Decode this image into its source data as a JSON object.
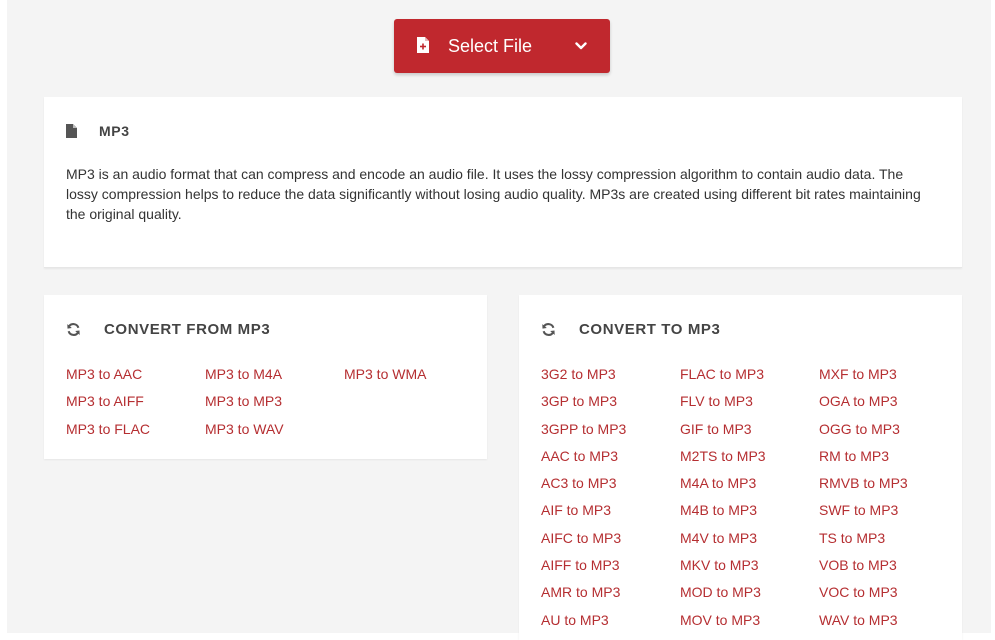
{
  "select_file": {
    "label": "Select File",
    "icon": "file-plus-icon",
    "dropdown_icon": "chevron-down-icon"
  },
  "format_info": {
    "icon": "document-icon",
    "name": "MP3",
    "description": "MP3 is an audio format that can compress and encode an audio file. It uses the lossy compression algorithm to contain audio data. The lossy compression helps to reduce the data significantly without losing audio quality. MP3s are created using different bit rates maintaining the original quality."
  },
  "convert_from": {
    "icon": "refresh-icon",
    "title": "CONVERT FROM MP3",
    "links": [
      "MP3 to AAC",
      "MP3 to AIFF",
      "MP3 to FLAC",
      "MP3 to M4A",
      "MP3 to MP3",
      "MP3 to WAV",
      "MP3 to WMA"
    ]
  },
  "convert_to": {
    "icon": "refresh-icon",
    "title": "CONVERT TO MP3",
    "links": [
      "3G2 to MP3",
      "3GP to MP3",
      "3GPP to MP3",
      "AAC to MP3",
      "AC3 to MP3",
      "AIF to MP3",
      "AIFC to MP3",
      "AIFF to MP3",
      "AMR to MP3",
      "AU to MP3",
      "FLAC to MP3",
      "FLV to MP3",
      "GIF to MP3",
      "M2TS to MP3",
      "M4A to MP3",
      "M4B to MP3",
      "M4V to MP3",
      "MKV to MP3",
      "MOD to MP3",
      "MOV to MP3",
      "MXF to MP3",
      "OGA to MP3",
      "OGG to MP3",
      "RM to MP3",
      "RMVB to MP3",
      "SWF to MP3",
      "TS to MP3",
      "VOB to MP3",
      "VOC to MP3",
      "WAV to MP3"
    ]
  },
  "colors": {
    "accent": "#c0282e",
    "link": "#b52e31",
    "background": "#f4f4f4",
    "card": "#ffffff"
  }
}
